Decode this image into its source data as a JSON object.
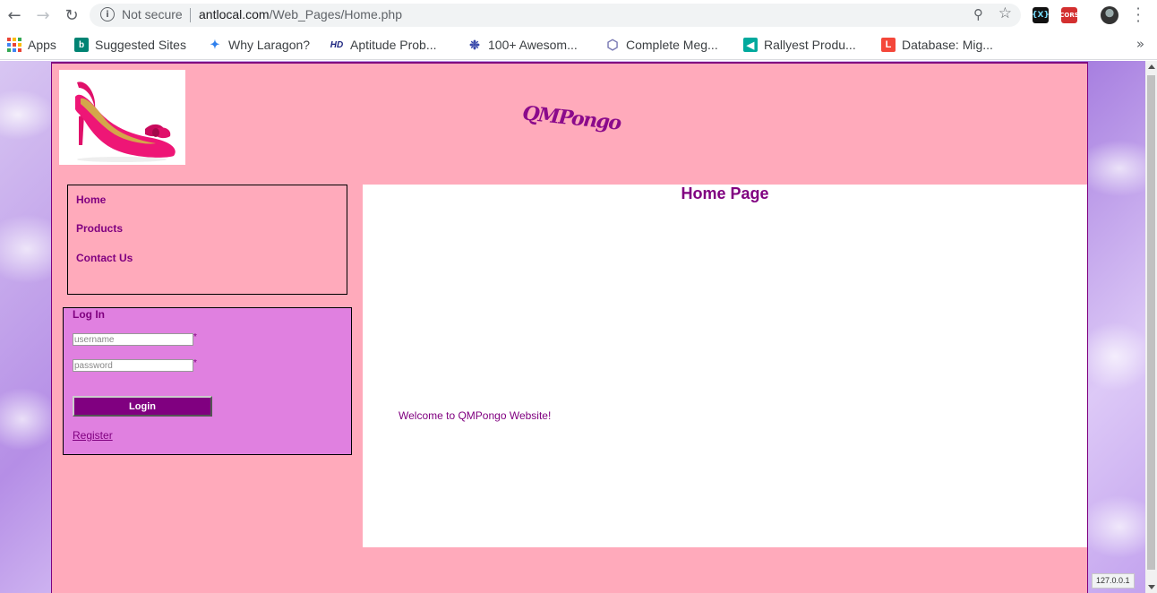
{
  "browser": {
    "security_label": "Not secure",
    "url_host": "antlocal.com",
    "url_path": "/Web_Pages/Home.php",
    "extensions": [
      {
        "name": "x-extension-icon",
        "label": "{X}"
      },
      {
        "name": "cors-extension-icon",
        "label": "CORS"
      }
    ],
    "status_url": "127.0.0.1"
  },
  "bookmarks": [
    {
      "label": "Apps",
      "icon": "apps-grid-icon"
    },
    {
      "label": "Suggested Sites",
      "icon": "bing-icon",
      "color": "#008373"
    },
    {
      "label": "Why Laragon?",
      "icon": "laragon-icon",
      "color": "#2f80ed"
    },
    {
      "label": "Aptitude Prob...",
      "icon": "hd-icon",
      "color": "#1a237e"
    },
    {
      "label": "100+ Awesom...",
      "icon": "awesome-icon",
      "color": "#3949ab"
    },
    {
      "label": "Complete Meg...",
      "icon": "cube-icon",
      "color": "#7b7bb5"
    },
    {
      "label": "Rallyest Produ...",
      "icon": "rallyest-icon",
      "color": "#00a99d"
    },
    {
      "label": "Database: Mig...",
      "icon": "laravel-icon",
      "color": "#f4473a"
    }
  ],
  "site": {
    "title": "QMPongo",
    "nav": [
      "Home",
      "Products",
      "Contact Us"
    ],
    "login": {
      "title": "Log In",
      "username_placeholder": "username",
      "password_placeholder": "password",
      "required_mark": "*",
      "button_label": "Login",
      "register_label": "Register"
    },
    "content": {
      "title": "Home Page",
      "welcome": "Welcome to QMPongo Website!"
    }
  },
  "colors": {
    "accent": "#800080",
    "page_background": "#ffaabb",
    "login_panel": "#e080e0"
  }
}
